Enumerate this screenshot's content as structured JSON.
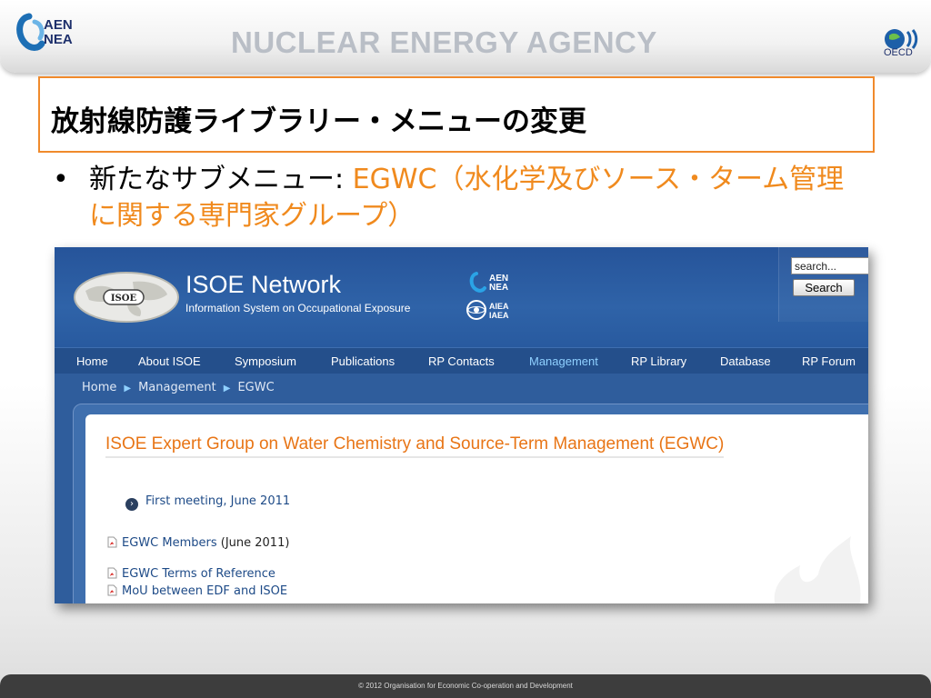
{
  "slide_header": {
    "aen_logo_text": "AEN\nNEA",
    "agency_title": "NUCLEAR ENERGY AGENCY",
    "oecd_logo_text": "OECD"
  },
  "slide": {
    "title": "放射線防護ライブラリー・メニューの変更",
    "bullet_prefix": "新たなサブメニュー: ",
    "bullet_highlight_line1": "EGWC（水化学及びソース・ターム管理",
    "bullet_highlight_line2": "に関する専門家グループ）",
    "accent_color": "#f08a1e",
    "title_border_color": "#f08a2c"
  },
  "isoe_site": {
    "globe_label": "ISOE",
    "site_name": "ISOE Network",
    "site_subtitle": "Information System on Occupational Exposure",
    "partner_logo_1": "AEN\nNEA",
    "partner_logo_2": "AIEA\nIAEA",
    "search": {
      "placeholder": "search...",
      "button_label": "Search"
    },
    "nav": [
      {
        "label": "Home"
      },
      {
        "label": "About ISOE"
      },
      {
        "label": "Symposium"
      },
      {
        "label": "Publications"
      },
      {
        "label": "RP Contacts"
      },
      {
        "label": "Management",
        "active": true
      },
      {
        "label": "RP Library"
      },
      {
        "label": "Database"
      },
      {
        "label": "RP Forum"
      }
    ],
    "breadcrumb": [
      "Home",
      "Management",
      "EGWC"
    ],
    "page_heading": "ISOE Expert Group on Water Chemistry and Source-Term Management (EGWC)",
    "first_meeting_link": "First meeting, June 2011",
    "documents": [
      {
        "label": "EGWC Members",
        "note": " (June 2011)"
      },
      {
        "label": "EGWC Terms of Reference",
        "note": ""
      },
      {
        "label": "MoU between EDF and ISOE",
        "note": ""
      }
    ],
    "colors": {
      "banner": "#2f63a8",
      "heading": "#e87516",
      "link": "#1d4a87",
      "nav_active": "#8fd0ff"
    }
  },
  "footer": {
    "copyright": "© 2012 Organisation for Economic Co-operation and Development"
  }
}
